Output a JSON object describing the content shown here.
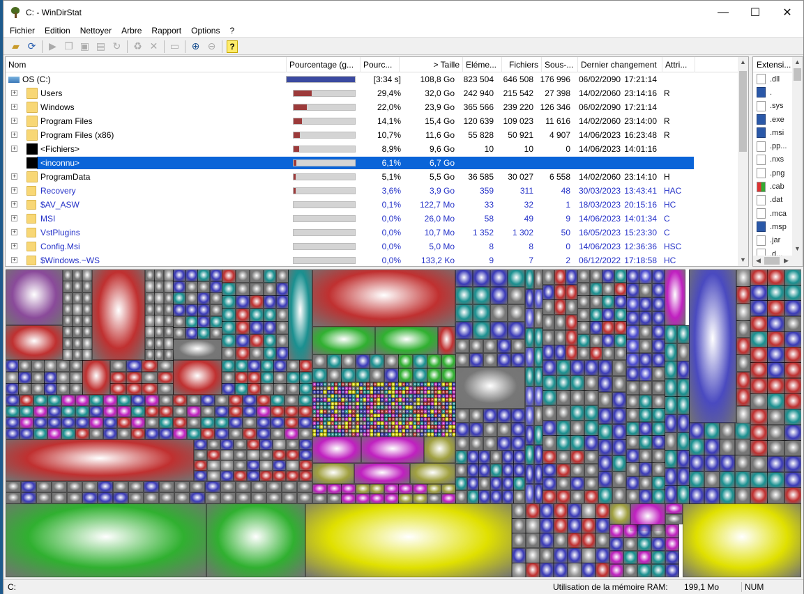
{
  "window": {
    "title": "C: - WinDirStat",
    "controls": {
      "minimize": "—",
      "maximize": "☐",
      "close": "✕"
    }
  },
  "menu": [
    "Fichier",
    "Edition",
    "Nettoyer",
    "Arbre",
    "Rapport",
    "Options",
    "?"
  ],
  "columns": [
    "Nom",
    "Pourcentage (g...",
    "Pourc...",
    "> Taille",
    "Eléme...",
    "Fichiers",
    "Sous-...",
    "Dernier changement",
    "Attri..."
  ],
  "rows": [
    {
      "name": "OS (C:)",
      "icon": "drive-icon",
      "level": 0,
      "bar": 1.0,
      "bar_color": "#3b4aa0",
      "pct": "[3:34 s]",
      "size": "108,8 Go",
      "items": "823 504",
      "files": "646 508",
      "subdirs": "176 996",
      "date": "06/02/2090",
      "time": "17:21:14",
      "attr": ""
    },
    {
      "name": "Users",
      "icon": "folder-icon",
      "level": 1,
      "bar": 0.294,
      "bar_color": "#9c3a3a",
      "pct": "29,4%",
      "size": "32,0 Go",
      "items": "242 940",
      "files": "215 542",
      "subdirs": "27 398",
      "date": "14/02/2060",
      "time": "23:14:16",
      "attr": "R"
    },
    {
      "name": "Windows",
      "icon": "folder-icon",
      "level": 1,
      "bar": 0.22,
      "bar_color": "#9c3a3a",
      "pct": "22,0%",
      "size": "23,9 Go",
      "items": "365 566",
      "files": "239 220",
      "subdirs": "126 346",
      "date": "06/02/2090",
      "time": "17:21:14",
      "attr": ""
    },
    {
      "name": "Program Files",
      "icon": "folder-icon",
      "level": 1,
      "bar": 0.141,
      "bar_color": "#9c3a3a",
      "pct": "14,1%",
      "size": "15,4 Go",
      "items": "120 639",
      "files": "109 023",
      "subdirs": "11 616",
      "date": "14/02/2060",
      "time": "23:14:00",
      "attr": "R"
    },
    {
      "name": "Program Files (x86)",
      "icon": "folder-icon",
      "level": 1,
      "bar": 0.107,
      "bar_color": "#9c3a3a",
      "pct": "10,7%",
      "size": "11,6 Go",
      "items": "55 828",
      "files": "50 921",
      "subdirs": "4 907",
      "date": "14/06/2023",
      "time": "16:23:48",
      "attr": "R"
    },
    {
      "name": "<Fichiers>",
      "icon": "black-icon",
      "level": 1,
      "bar": 0.089,
      "bar_color": "#9c3a3a",
      "pct": "8,9%",
      "size": "9,6 Go",
      "items": "10",
      "files": "10",
      "subdirs": "0",
      "date": "14/06/2023",
      "time": "14:01:16",
      "attr": ""
    },
    {
      "name": "<inconnu>",
      "icon": "black-icon",
      "level": 1,
      "bar": 0.061,
      "bar_color": "#9c3a3a",
      "pct": "6,1%",
      "size": "6,7 Go",
      "items": "",
      "files": "",
      "subdirs": "",
      "date": "",
      "time": "",
      "attr": "",
      "selected": true,
      "noexpand": true
    },
    {
      "name": "ProgramData",
      "icon": "folder-icon",
      "level": 1,
      "bar": 0.051,
      "bar_color": "#9c3a3a",
      "pct": "5,1%",
      "size": "5,5 Go",
      "items": "36 585",
      "files": "30 027",
      "subdirs": "6 558",
      "date": "14/02/2060",
      "time": "23:14:10",
      "attr": "H"
    },
    {
      "name": "Recovery",
      "icon": "folder-icon",
      "level": 1,
      "bar": 0.036,
      "bar_color": "#9c3a3a",
      "pct": "3,6%",
      "size": "3,9 Go",
      "items": "359",
      "files": "311",
      "subdirs": "48",
      "date": "30/03/2023",
      "time": "13:43:41",
      "attr": "HAC",
      "compressed": true
    },
    {
      "name": "$AV_ASW",
      "icon": "folder-icon",
      "level": 1,
      "bar": 0.001,
      "bar_color": "#9c3a3a",
      "pct": "0,1%",
      "size": "122,7 Mo",
      "items": "33",
      "files": "32",
      "subdirs": "1",
      "date": "18/03/2023",
      "time": "20:15:16",
      "attr": "HC",
      "compressed": true
    },
    {
      "name": "MSI",
      "icon": "folder-icon",
      "level": 1,
      "bar": 0.0,
      "bar_color": "#9c3a3a",
      "pct": "0,0%",
      "size": "26,0 Mo",
      "items": "58",
      "files": "49",
      "subdirs": "9",
      "date": "14/06/2023",
      "time": "14:01:34",
      "attr": "C",
      "compressed": true
    },
    {
      "name": "VstPlugins",
      "icon": "folder-icon",
      "level": 1,
      "bar": 0.0,
      "bar_color": "#9c3a3a",
      "pct": "0,0%",
      "size": "10,7 Mo",
      "items": "1 352",
      "files": "1 302",
      "subdirs": "50",
      "date": "16/05/2023",
      "time": "15:23:30",
      "attr": "C",
      "compressed": true
    },
    {
      "name": "Config.Msi",
      "icon": "folder-icon",
      "level": 1,
      "bar": 0.0,
      "bar_color": "#9c3a3a",
      "pct": "0,0%",
      "size": "5,0 Mo",
      "items": "8",
      "files": "8",
      "subdirs": "0",
      "date": "14/06/2023",
      "time": "12:36:36",
      "attr": "HSC",
      "compressed": true
    },
    {
      "name": "$Windows.~WS",
      "icon": "folder-icon",
      "level": 1,
      "bar": 0.0,
      "bar_color": "#9c3a3a",
      "pct": "0,0%",
      "size": "133,2 Ko",
      "items": "9",
      "files": "7",
      "subdirs": "2",
      "date": "06/12/2022",
      "time": "17:18:58",
      "attr": "HC",
      "compressed": true
    }
  ],
  "extensions": {
    "header": "Extensi...",
    "items": [
      {
        "label": ".dll",
        "icon": "file"
      },
      {
        "label": ".",
        "icon": "blue"
      },
      {
        "label": ".sys",
        "icon": "file"
      },
      {
        "label": ".exe",
        "icon": "blue"
      },
      {
        "label": ".msi",
        "icon": "blue"
      },
      {
        "label": ".pp...",
        "icon": "file"
      },
      {
        "label": ".nxs",
        "icon": "file"
      },
      {
        "label": ".png",
        "icon": "file"
      },
      {
        "label": ".cab",
        "icon": "multi"
      },
      {
        "label": ".dat",
        "icon": "file"
      },
      {
        "label": ".mca",
        "icon": "file"
      },
      {
        "label": ".msp",
        "icon": "blue"
      },
      {
        "label": ".jar",
        "icon": "file"
      },
      {
        "label": ".d...",
        "icon": "file"
      }
    ]
  },
  "status": {
    "path": "C:",
    "memory": "Utilisation de la mémoire RAM:       199,1 Mo",
    "num": "NUM"
  },
  "colors": {
    "selection": "#0a64d8",
    "compressed_text": "#2431c8",
    "treemap_red": "#c03030",
    "treemap_blue": "#3a3ab8",
    "treemap_green": "#30b030",
    "treemap_yellow": "#e0e000",
    "treemap_magenta": "#c020c0",
    "treemap_teal": "#1a9090",
    "treemap_grey": "#777777",
    "treemap_olive": "#a0a040"
  }
}
